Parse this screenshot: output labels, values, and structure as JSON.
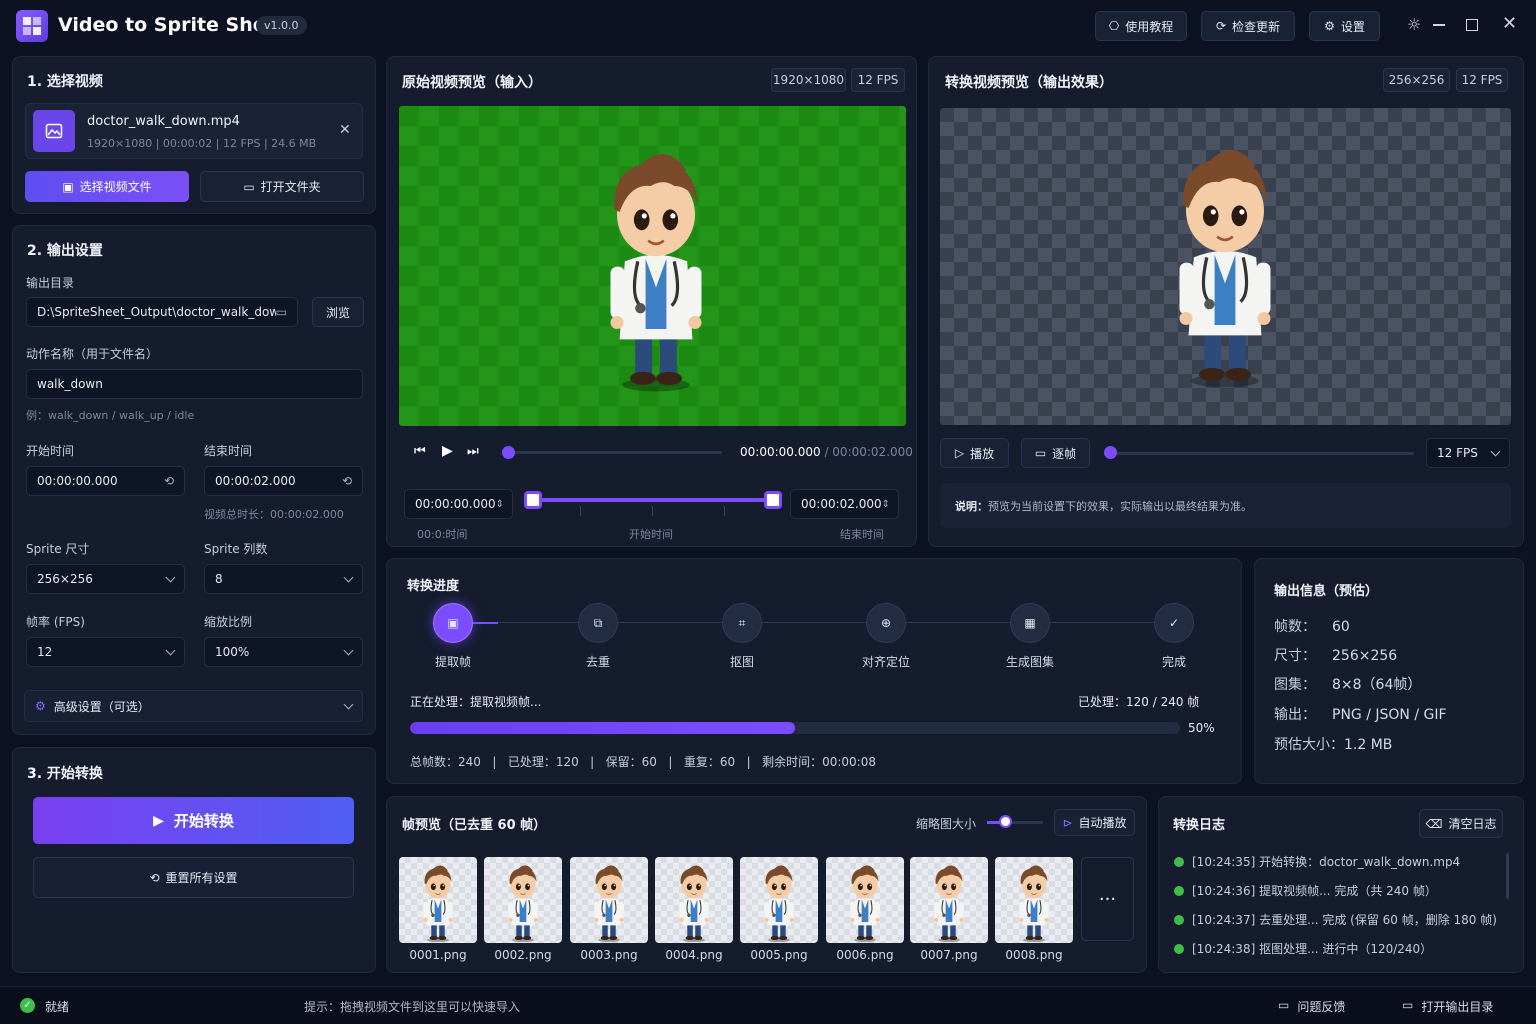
{
  "app": {
    "title": "Video to Sprite Sheet",
    "version": "v1.0.0",
    "tutorial": "使用教程",
    "check_update": "检查更新",
    "settings": "设置"
  },
  "section1": {
    "title": "1. 选择视频",
    "file_name": "doctor_walk_down.mp4",
    "file_meta": "1920×1080 | 00:00:02 | 12 FPS | 24.6 MB",
    "select_btn": "选择视频文件",
    "open_folder_btn": "打开文件夹"
  },
  "section2": {
    "title": "2. 输出设置",
    "outdir_label": "输出目录",
    "outdir_value": "D:\\SpriteSheet_Output\\doctor_walk_down",
    "browse_btn": "浏览",
    "action_label": "动作名称（用于文件名）",
    "action_value": "walk_down",
    "action_hint": "例：walk_down / walk_up / idle",
    "start_label": "开始时间",
    "start_value": "00:00:00.000",
    "end_label": "结束时间",
    "end_value": "00:00:02.000",
    "total_duration": "视频总时长：00:00:02.000",
    "sprite_size_label": "Sprite 尺寸",
    "sprite_size_value": "256×256",
    "sprite_cols_label": "Sprite 列数",
    "sprite_cols_value": "8",
    "fps_label": "帧率 (FPS)",
    "fps_value": "12",
    "scale_label": "缩放比例",
    "scale_value": "100%",
    "advanced": "高级设置（可选）"
  },
  "section3": {
    "title": "3. 开始转换",
    "start_btn": "开始转换",
    "reset_btn": "重置所有设置"
  },
  "input_preview": {
    "title": "原始视频预览（输入）",
    "resolution": "1920×1080",
    "fps": "12 FPS",
    "time_current": "00:00:00.000",
    "time_total": " / 00:00:02.000",
    "range_start": "00:00:00.000",
    "range_end": "00:00:02.000",
    "label_zero": "00:0:时间",
    "label_start": "开始时间",
    "label_end": "结束时间",
    "playhead": 0.0
  },
  "output_preview": {
    "title": "转换视频预览（输出效果）",
    "resolution": "256×256",
    "fps": "12 FPS",
    "play_btn": "播放",
    "step_btn": "逐帧",
    "fps_select": "12 FPS",
    "note_label": "说明：",
    "note_text": "预览为当前设置下的效果，实际输出以最终结果为准。"
  },
  "progress": {
    "title": "转换进度",
    "steps": [
      "提取帧",
      "去重",
      "抠图",
      "对齐定位",
      "生成图集",
      "完成"
    ],
    "status": "正在处理：提取视频帧...",
    "processed": "已处理：120 / 240 帧",
    "percent_text": "50%",
    "percent": 0.5,
    "stats": "总帧数：240   |   已处理：120   |   保留：60   |   重复：60   |   剩余时间：00:00:08"
  },
  "output_info": {
    "title": "输出信息（预估）",
    "rows": [
      {
        "k": "帧数：",
        "v": "60"
      },
      {
        "k": "尺寸：",
        "v": "256×256"
      },
      {
        "k": "图集：",
        "v": "8×8（64帧）"
      },
      {
        "k": "输出：",
        "v": "PNG / JSON / GIF"
      },
      {
        "k": "预估大小：",
        "v": "1.2 MB"
      }
    ]
  },
  "frames": {
    "title": "帧预览（已去重 60 帧）",
    "thumb_size_label": "缩略图大小",
    "autoplay": "自动播放",
    "items": [
      "0001.png",
      "0002.png",
      "0003.png",
      "0004.png",
      "0005.png",
      "0006.png",
      "0007.png",
      "0008.png"
    ],
    "more": "···"
  },
  "log": {
    "title": "转换日志",
    "clear": "清空日志",
    "lines": [
      "[10:24:35] 开始转换：doctor_walk_down.mp4",
      "[10:24:36] 提取视频帧...   完成（共 240 帧）",
      "[10:24:37] 去重处理... 完成 (保留 60 帧，删除 180 帧)",
      "[10:24:38] 抠图处理...   进行中（120/240）"
    ]
  },
  "statusbar": {
    "ready": "就绪",
    "hint": "提示：拖拽视频文件到这里可以快速导入",
    "feedback": "问题反馈",
    "open_output": "打开输出目录"
  },
  "colors": {
    "accent": "#7c4dff",
    "bg": "#0c1221",
    "panel": "#141c2e",
    "success": "#3fbf4a"
  }
}
